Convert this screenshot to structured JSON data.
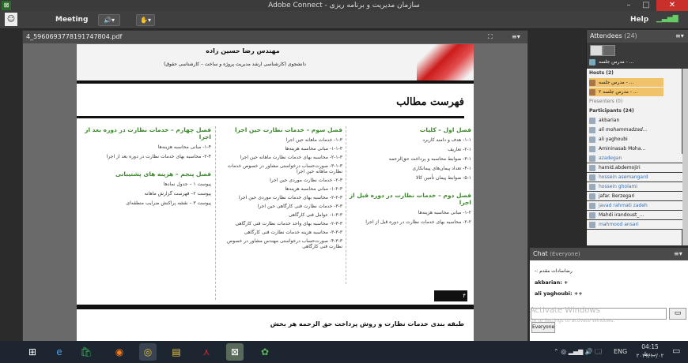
{
  "window": {
    "title": "Adobe Connect - سازمان مدیریت و برنامه ریزی"
  },
  "menu": {
    "meeting": "Meeting",
    "help": "Help"
  },
  "doc": {
    "filename": "4_5960693778191747804.pdf",
    "slide_header_name": "مهندس رضا حسین زاده",
    "slide_header_sub": "دانشجوی (کارشناسی ارشد مدیریت پروژه و ساخت – کارشناسی حقوق)",
    "toc_title": "فهرست مطالب",
    "col1_head": "فصل اول – کلیات",
    "col1_items": [
      "۱-۱- هدف و دامنه کاربرد",
      "۲-۱- تعاریف",
      "۳-۱- ضوابط محاسبه و پرداخت حق‌الزحمه",
      "۴-۱- تعداد پیمان‌های پیمانکاری",
      "۵-۱- ضوابط پیمان تأمین کالا"
    ],
    "col1b_head": "فصل دوم – خدمات نظارت در دوره قبل از اجرا",
    "col1b_items": [
      "۱-۲- مبانی محاسبه هزینه‌ها",
      "۲-۲- محاسبه بهای خدمات نظارت در دوره قبل از اجرا"
    ],
    "col2_head": "فصل سوم – خدمات نظارت حین اجرا",
    "col2_items": [
      "۱-۳- خدمات ماهانه حین اجرا",
      "۱-۱-۳- مبانی محاسبه هزینه‌ها",
      "۲-۱-۳- محاسبه بهای خدمات نظارت ماهانه حین اجرا",
      "۳-۱-۳- صورت‌حساب درخواستی مشاور در خصوص خدمات نظارت ماهانه حین اجرا",
      "۲-۳- خدمات نظارت موردی حین اجرا",
      "۱-۲-۳- مبانی محاسبه هزینه‌ها",
      "۲-۲-۳- محاسبه بهای خدمات نظارت موردی حین اجرا",
      "۳-۳- خدمات نظارت فنی کارگاهی حین اجرا",
      "۱-۳-۳- عوامل فنی کارگاهی",
      "۲-۳-۳- محاسبه بهای واحد خدمات نظارت فنی کارگاهی",
      "۳-۳-۳- محاسبه هزینه خدمات نظارت فنی کارگاهی",
      "۴-۳-۳- صورت‌حساب درخواستی مهندس مشاور در خصوص نظارت فنی کارگاهی"
    ],
    "col3_head": "فصل چهارم – خدمات نظارت در دوره بعد از اجرا",
    "col3_items": [
      "۱-۴- مبانی محاسبه هزینه‌ها",
      "۲-۴- محاسبه بهای خدمات نظارت در دوره بعد از اجرا"
    ],
    "col3b_head": "فصل پنجم – هزینه های پشتیبانی",
    "col3b_items": [
      "پیوست ۱ – جدول نمادها",
      "پیوست ۲– فهرست گزارش ماهانه",
      "پیوست ۳ – نقشه پراکنش ضرایب منطقه‌ای"
    ],
    "page_num": "۴",
    "bottom_heading": "طبقه بندی خدمات نظارت و روش پرداخت حق الزحمه هر بخش"
  },
  "attendees": {
    "title": "Attendees",
    "count": "(24)",
    "me": "مدرس جلسه - ...",
    "hosts_label": "Hosts (2)",
    "hosts": [
      "مدرس جلسه - ...",
      "مدرس جلسه ۲ - ..."
    ],
    "presenters_label": "Presenters (0)",
    "participants_label": "Participants (24)",
    "participants": [
      "akbarian",
      "ali mohammadzad...",
      "ali yaghoubi",
      "Amininasab Moha...",
      "azadegan",
      "hamid.abdemojiri",
      "hossein asemangard",
      "hossein gholami",
      "jafar. Berzegari",
      "javad rahmati zadeh",
      "Mahdi irandoust_...",
      "mahmood ansari"
    ]
  },
  "chat": {
    "title": "Chat",
    "scope": "(Everyone)",
    "messages": [
      "-: رضاسادات مقدم",
      "akbarian: +",
      "ali yaghoubi: ++"
    ],
    "audience": "Everyone",
    "watermark1": "Activate Windows",
    "watermark2": "Go to Settings to activate Windows."
  },
  "taskbar": {
    "lang": "ENG",
    "time": "04:15 ب.ظ",
    "date": "۲۰۲۱/۱۰/۰۲"
  },
  "colors": {
    "accent_red": "#cc1b1b",
    "toc_green": "#3a8a2a",
    "chrome_dark": "#3a3a3a",
    "close_red": "#c9302c"
  }
}
